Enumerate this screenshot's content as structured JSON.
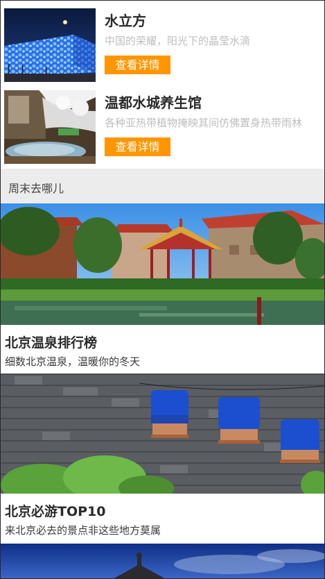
{
  "venues": [
    {
      "name": "水立方",
      "desc": "中国的荣耀，阳光下的晶莹水滴",
      "button": "查看详情"
    },
    {
      "name": "温都水城养生馆",
      "desc": "各种亚热带植物掩映其间仿佛置身热带雨林",
      "button": "查看详情"
    }
  ],
  "section": {
    "title": "周末去哪儿"
  },
  "features": [
    {
      "title": "北京温泉排行榜",
      "subtitle": "细数北京温泉，温暖你的冬天"
    },
    {
      "title": "北京必游TOP10",
      "subtitle": "来北京必去的景点非这些地方莫属"
    }
  ],
  "colors": {
    "button": "#ff9600",
    "section_bg": "#ececec",
    "muted_text": "#bdbdbd"
  }
}
